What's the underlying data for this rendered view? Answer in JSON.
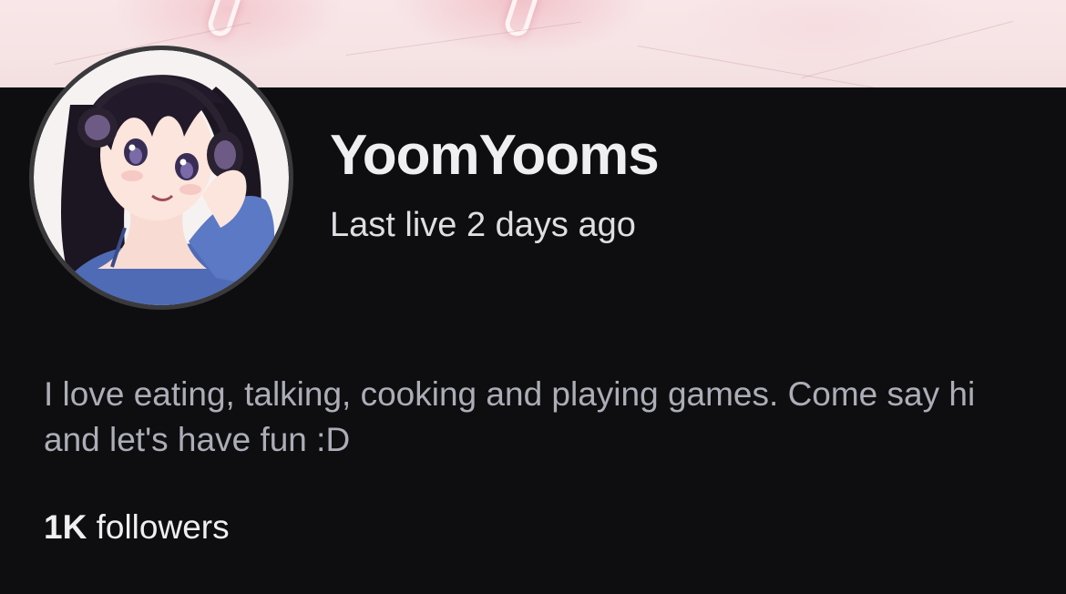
{
  "profile": {
    "channel_name": "YoomYooms",
    "last_live": "Last live 2 days ago",
    "bio": "I love eating, talking, cooking and playing games. Come say hi and let's have fun :D",
    "followers_count": "1K",
    "followers_label": "followers"
  },
  "icons": {
    "avatar": "anime-girl-avatar"
  },
  "colors": {
    "background": "#0e0e10",
    "text_primary": "#efeff1",
    "text_secondary": "#adadb8",
    "avatar_ring": "#3a3a3d",
    "banner": "#f6e4e5"
  }
}
